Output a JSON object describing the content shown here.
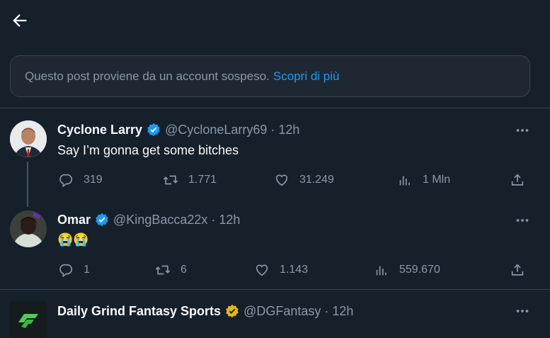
{
  "notice": {
    "text": "Questo post proviene da un account sospeso.",
    "link": "Scopri di più"
  },
  "tweets": [
    {
      "name": "Cyclone Larry",
      "handle": "@CycloneLarry69",
      "time": "12h",
      "verified_color": "#1d9bf0",
      "text": "Say I’m gonna get some bitches",
      "stats": {
        "replies": "319",
        "reposts": "1.771",
        "likes": "31.249",
        "views": "1 Mln"
      }
    },
    {
      "name": "Omar",
      "handle": "@KingBacca22x",
      "time": "12h",
      "verified_color": "#1d9bf0",
      "text": "😭😭",
      "stats": {
        "replies": "1",
        "reposts": "6",
        "likes": "1.143",
        "views": "559.670"
      }
    },
    {
      "name": "Daily Grind Fantasy Sports",
      "handle": "@DGFantasy",
      "time": "12h",
      "verified_color": "#e2b719"
    }
  ],
  "separator": "·",
  "icons": [
    "back-arrow-icon",
    "verified-badge-icon",
    "more-icon",
    "reply-icon",
    "repost-icon",
    "like-icon",
    "views-icon",
    "share-icon"
  ]
}
